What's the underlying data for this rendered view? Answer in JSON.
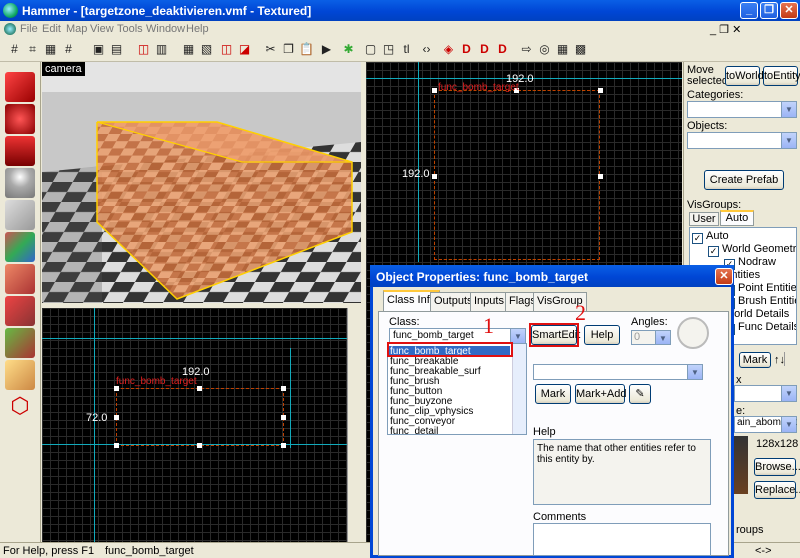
{
  "window": {
    "title": "Hammer - [targetzone_deaktivieren.vmf - Textured]",
    "min": "_",
    "max": "❐",
    "close": "✕"
  },
  "menu": [
    "File",
    "Edit",
    "Map",
    "View",
    "Tools",
    "Window",
    "Help"
  ],
  "toolbar_icons": [
    "grid-icon",
    "grid-decrease-icon",
    "grid-increase-icon",
    "grid-toggle-icon",
    "carve-icon",
    "group-icon",
    "ungroup-icon",
    "hide-icon",
    "cut-icon",
    "copy-icon",
    "paste-icon",
    "run-map-icon",
    "texture-lock-icon",
    "toggle-select-icon",
    "to-world-icon",
    "to-entity-icon",
    "decal-icon",
    "brush-icon",
    "entity-icon",
    "cordon-icon",
    "overlay-icon"
  ],
  "left_tools": [
    "selection-tool-icon",
    "magnify-tool-icon",
    "camera-tool-icon",
    "entity-tool-icon",
    "block-tool-icon",
    "texture-tool-icon",
    "apply-texture-icon",
    "decal-tool-icon",
    "overlay-tool-icon",
    "clipping-tool-icon",
    "vertex-tool-icon"
  ],
  "viewport_3d": {
    "label": "camera"
  },
  "viewport_top_right": {
    "dim_top": "192.0",
    "dim_left": "192.0",
    "entity_label": "func_bomb_target"
  },
  "viewport_bottom_left": {
    "dim_top": "192.0",
    "dim_left": "72.0",
    "entity_label": "func_bomb_target"
  },
  "right_panel": {
    "move_selected": "Move selected:",
    "to_world": "toWorld",
    "to_entity": "toEntity",
    "categories_label": "Categories:",
    "objects_label": "Objects:",
    "create_prefab": "Create Prefab",
    "visgroups_label": "VisGroups:",
    "tabs": [
      "User",
      "Auto"
    ],
    "tree": [
      "Auto",
      "World Geometry",
      "Nodraw",
      "Entities",
      "Point Entities",
      "Brush Entities",
      "World Details",
      "Func Details"
    ],
    "mark_btn": "Mark",
    "texture_partial_x": "x",
    "texture_partial_e": "e:",
    "texture_name": "ain_abombsit",
    "texture_size": "128x128",
    "browse": "Browse...",
    "replace": "Replace...",
    "groups_partial": "roups",
    "arrows": "<->"
  },
  "status": {
    "help": "For Help, press F1",
    "selection": "func_bomb_target"
  },
  "dialog": {
    "title": "Object Properties: func_bomb_target",
    "tabs": [
      "Class Info",
      "Outputs",
      "Inputs",
      "Flags",
      "VisGroup"
    ],
    "class_label": "Class:",
    "class_value": "func_bomb_target",
    "smartedit": "SmartEdit",
    "help_btn": "Help",
    "angles_label": "Angles:",
    "angles_value": "0",
    "class_options": [
      "func_bomb_target",
      "func_breakable",
      "func_breakable_surf",
      "func_brush",
      "func_button",
      "func_buyzone",
      "func_clip_vphysics",
      "func_conveyor",
      "func_detail"
    ],
    "mark": "Mark",
    "mark_add": "Mark+Add",
    "help_label": "Help",
    "help_text": "The name that other entities refer to this entity by.",
    "comments_label": "Comments",
    "annot_1": "1",
    "annot_2": "2"
  },
  "colors": {
    "xp_blue": "#0046D5",
    "selection_orange": "#E87830",
    "annotation_red": "#E01010"
  }
}
